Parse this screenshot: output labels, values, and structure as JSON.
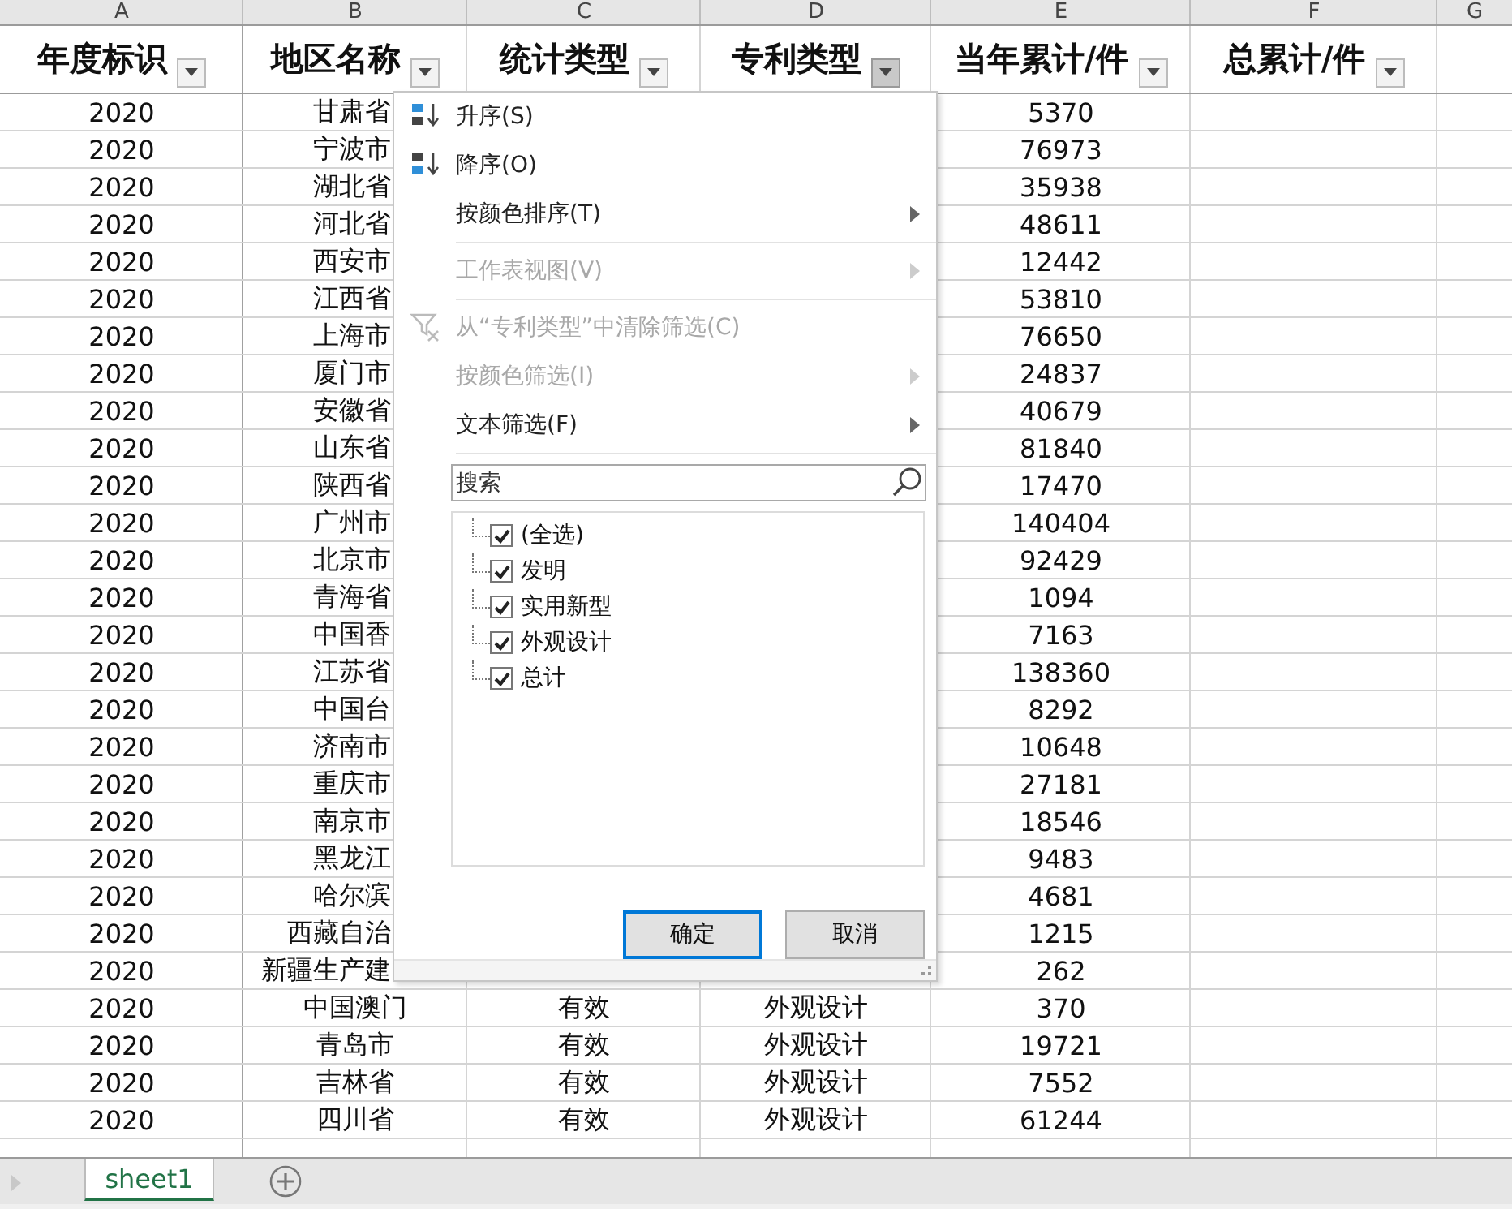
{
  "column_letters": [
    "A",
    "B",
    "C",
    "D",
    "E",
    "F",
    "G"
  ],
  "headers": [
    {
      "label": "年度标识",
      "filter_open": false
    },
    {
      "label": "地区名称",
      "filter_open": false
    },
    {
      "label": "统计类型",
      "filter_open": false
    },
    {
      "label": "专利类型",
      "filter_open": true
    },
    {
      "label": "当年累计/件",
      "filter_open": false
    },
    {
      "label": "总累计/件",
      "filter_open": false
    }
  ],
  "rows": [
    {
      "year": "2020",
      "region": "甘肃省",
      "amount": "5370"
    },
    {
      "year": "2020",
      "region": "宁波市",
      "amount": "76973"
    },
    {
      "year": "2020",
      "region": "湖北省",
      "amount": "35938"
    },
    {
      "year": "2020",
      "region": "河北省",
      "amount": "48611"
    },
    {
      "year": "2020",
      "region": "西安市",
      "amount": "12442"
    },
    {
      "year": "2020",
      "region": "江西省",
      "amount": "53810"
    },
    {
      "year": "2020",
      "region": "上海市",
      "amount": "76650"
    },
    {
      "year": "2020",
      "region": "厦门市",
      "amount": "24837"
    },
    {
      "year": "2020",
      "region": "安徽省",
      "amount": "40679"
    },
    {
      "year": "2020",
      "region": "山东省",
      "amount": "81840"
    },
    {
      "year": "2020",
      "region": "陕西省",
      "amount": "17470"
    },
    {
      "year": "2020",
      "region": "广州市",
      "amount": "140404"
    },
    {
      "year": "2020",
      "region": "北京市",
      "amount": "92429"
    },
    {
      "year": "2020",
      "region": "青海省",
      "amount": "1094"
    },
    {
      "year": "2020",
      "region": "中国香",
      "amount": "7163"
    },
    {
      "year": "2020",
      "region": "江苏省",
      "amount": "138360"
    },
    {
      "year": "2020",
      "region": "中国台",
      "amount": "8292"
    },
    {
      "year": "2020",
      "region": "济南市",
      "amount": "10648"
    },
    {
      "year": "2020",
      "region": "重庆市",
      "amount": "27181"
    },
    {
      "year": "2020",
      "region": "南京市",
      "amount": "18546"
    },
    {
      "year": "2020",
      "region": "黑龙江",
      "amount": "9483"
    },
    {
      "year": "2020",
      "region": "哈尔滨",
      "amount": "4681"
    },
    {
      "year": "2020",
      "region": "西藏自治",
      "amount": "1215"
    },
    {
      "year": "2020",
      "region": "新疆生产建",
      "amount": "262"
    },
    {
      "year": "2020",
      "region": "中国澳门",
      "stat_type": "有效",
      "patent_type": "外观设计",
      "amount": "370"
    },
    {
      "year": "2020",
      "region": "青岛市",
      "stat_type": "有效",
      "patent_type": "外观设计",
      "amount": "19721"
    },
    {
      "year": "2020",
      "region": "吉林省",
      "stat_type": "有效",
      "patent_type": "外观设计",
      "amount": "7552"
    },
    {
      "year": "2020",
      "region": "四川省",
      "stat_type": "有效",
      "patent_type": "外观设计",
      "amount": "61244"
    }
  ],
  "filter_menu": {
    "items": [
      {
        "kind": "sort-asc",
        "label": "升序(S)",
        "disabled": false,
        "submenu": false
      },
      {
        "kind": "sort-desc",
        "label": "降序(O)",
        "disabled": false,
        "submenu": false
      },
      {
        "kind": "plain",
        "label": "按颜色排序(T)",
        "disabled": false,
        "submenu": true
      },
      {
        "kind": "separator"
      },
      {
        "kind": "plain",
        "label": "工作表视图(V)",
        "disabled": true,
        "submenu": true
      },
      {
        "kind": "separator"
      },
      {
        "kind": "clear-filter",
        "label": "从“专利类型”中清除筛选(C)",
        "disabled": true,
        "submenu": false
      },
      {
        "kind": "plain",
        "label": "按颜色筛选(I)",
        "disabled": true,
        "submenu": true
      },
      {
        "kind": "plain",
        "label": "文本筛选(F)",
        "disabled": false,
        "submenu": true
      },
      {
        "kind": "separator"
      }
    ],
    "search": {
      "placeholder": "搜索"
    },
    "values": [
      {
        "label": "(全选)",
        "checked": true
      },
      {
        "label": "发明",
        "checked": true
      },
      {
        "label": "实用新型",
        "checked": true
      },
      {
        "label": "外观设计",
        "checked": true
      },
      {
        "label": "总计",
        "checked": true
      }
    ],
    "buttons": [
      {
        "label": "确定",
        "focused": true
      },
      {
        "label": "取消",
        "focused": false
      }
    ]
  },
  "sheet_tabs": [
    {
      "label": "sheet1",
      "selected": true
    }
  ]
}
